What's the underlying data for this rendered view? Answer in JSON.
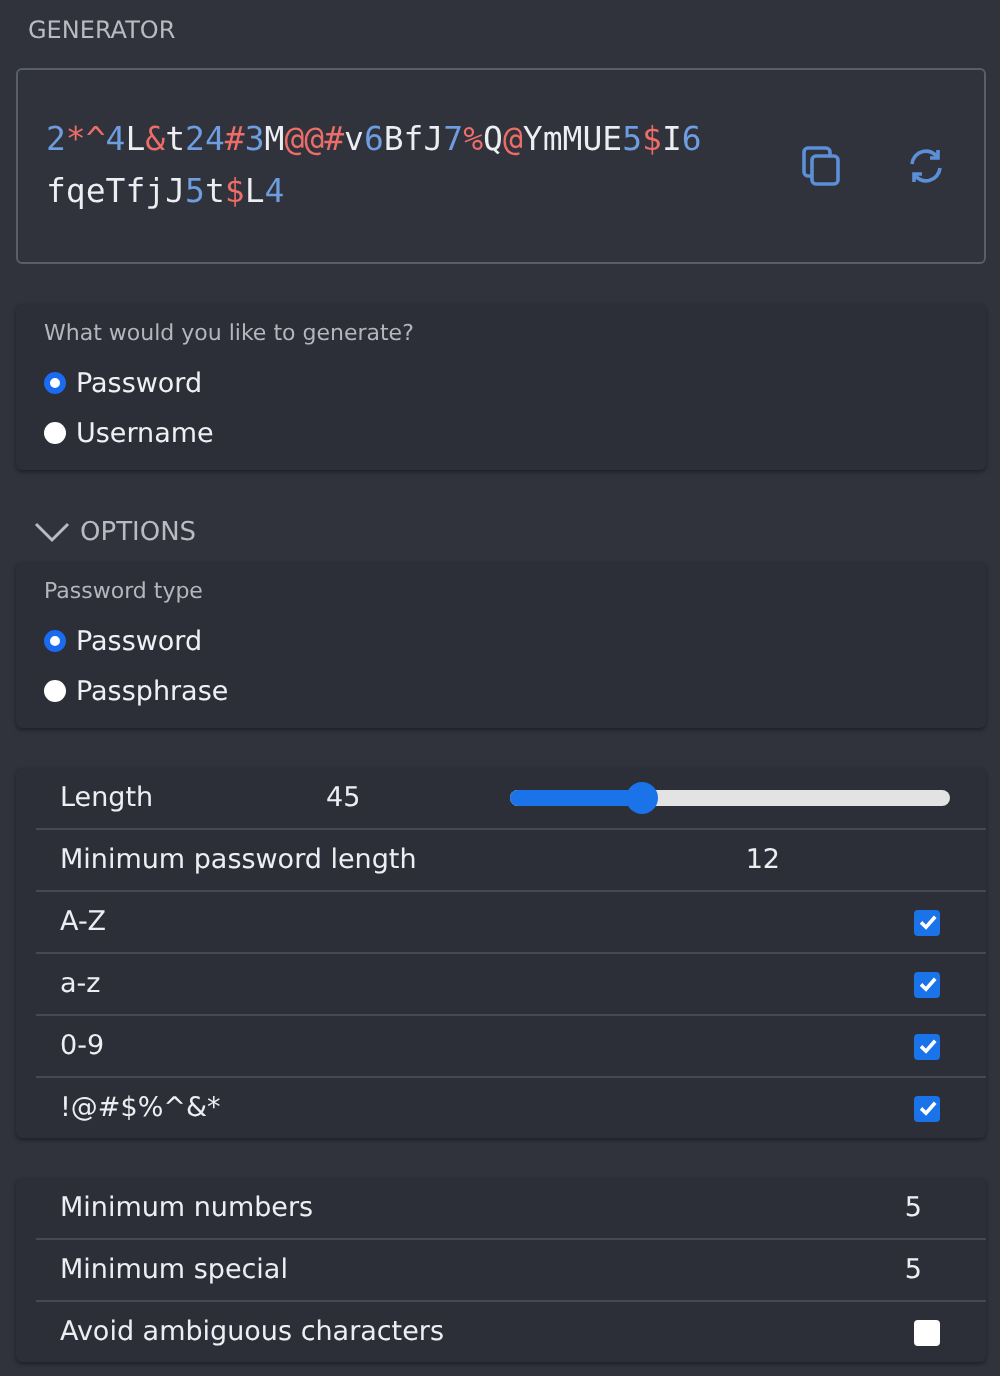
{
  "section_title": "GENERATOR",
  "generated": {
    "value": "2*^4L&t24#3M@@#v6BfJ7%Q@YmMUE5$I6fqeTfjJ5t$L4"
  },
  "generate_type": {
    "label": "What would you like to generate?",
    "options": [
      {
        "label": "Password",
        "selected": true
      },
      {
        "label": "Username",
        "selected": false
      }
    ]
  },
  "options_header": {
    "label": "OPTIONS",
    "expanded": true
  },
  "password_type": {
    "label": "Password type",
    "options": [
      {
        "label": "Password",
        "selected": true
      },
      {
        "label": "Passphrase",
        "selected": false
      }
    ]
  },
  "settings": [
    {
      "kind": "slider",
      "label": "Length",
      "value": "45",
      "level": 0.3
    },
    {
      "kind": "readonly",
      "label": "Minimum password length",
      "value": "12"
    },
    {
      "kind": "checkbox",
      "label": "A-Z",
      "checked": true
    },
    {
      "kind": "checkbox",
      "label": "a-z",
      "checked": true
    },
    {
      "kind": "checkbox",
      "label": "0-9",
      "checked": true
    },
    {
      "kind": "checkbox",
      "label": "!@#$%^&*",
      "checked": true
    }
  ],
  "advanced": [
    {
      "kind": "number",
      "label": "Minimum numbers",
      "value": "5"
    },
    {
      "kind": "number",
      "label": "Minimum special",
      "value": "5"
    },
    {
      "kind": "checkbox",
      "label": "Avoid ambiguous characters",
      "checked": false
    }
  ]
}
